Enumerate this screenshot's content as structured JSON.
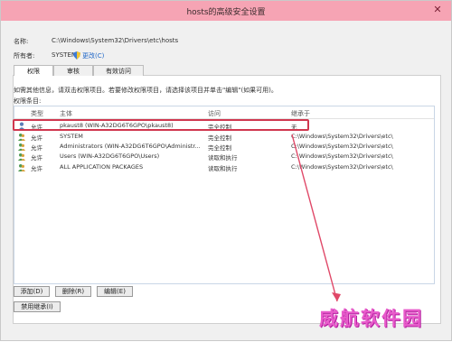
{
  "window": {
    "title": "hosts的高级安全设置",
    "close_symbol": "✕"
  },
  "fields": {
    "name_label": "名称:",
    "name_value": "C:\\Windows\\System32\\Drivers\\etc\\hosts",
    "owner_label": "所有者:",
    "owner_value": "SYSTEM",
    "change_link": "更改(C)"
  },
  "tabs": [
    {
      "label": "权限"
    },
    {
      "label": "审核"
    },
    {
      "label": "有效访问"
    }
  ],
  "info_text": "如需其他信息，请双击权限项目。若要修改权限项目，请选择该项目并单击\"编辑\"(如果可用)。",
  "list_label": "权限条目:",
  "columns": {
    "type": "类型",
    "principal": "主体",
    "access": "访问",
    "inherited": "继承于"
  },
  "rows": [
    {
      "type": "允许",
      "principal": "pkaust8 (WIN-A32DG6T6GPO\\pkaust8)",
      "access": "完全控制",
      "inherited": "无"
    },
    {
      "type": "允许",
      "principal": "SYSTEM",
      "access": "完全控制",
      "inherited": "C:\\Windows\\System32\\Drivers\\etc\\"
    },
    {
      "type": "允许",
      "principal": "Administrators (WIN-A32DG6T6GPO\\Administr...",
      "access": "完全控制",
      "inherited": "C:\\Windows\\System32\\Drivers\\etc\\"
    },
    {
      "type": "允许",
      "principal": "Users (WIN-A32DG6T6GPO\\Users)",
      "access": "读取和执行",
      "inherited": "C:\\Windows\\System32\\Drivers\\etc\\"
    },
    {
      "type": "允许",
      "principal": "ALL APPLICATION PACKAGES",
      "access": "读取和执行",
      "inherited": "C:\\Windows\\System32\\Drivers\\etc\\"
    }
  ],
  "buttons": {
    "add": "添加(D)",
    "remove": "删除(R)",
    "edit": "编辑(E)",
    "disable_inheritance": "禁用继承(I)"
  },
  "watermark": "威航软件园",
  "colors": {
    "titlebar": "#f6a4b4",
    "highlight": "#d0374f",
    "link": "#1e66c7",
    "watermark": "#e85bcb"
  }
}
